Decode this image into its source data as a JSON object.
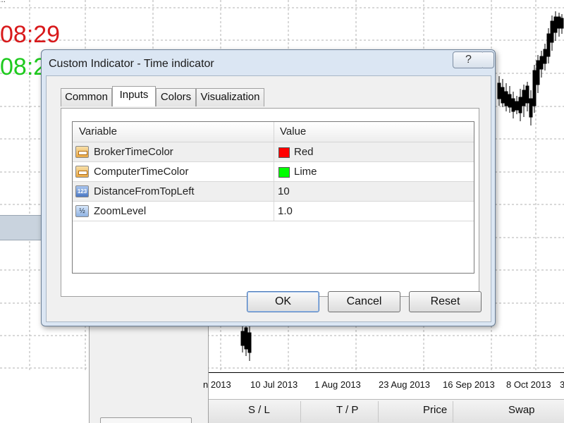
{
  "chart": {
    "title_fragment": "...",
    "broker_time": "08:29",
    "computer_time": "08:2",
    "broker_color": "#d8191b",
    "computer_color": "#1fca1f",
    "date_labels": [
      "n 2013",
      "10 Jul 2013",
      "1 Aug 2013",
      "23 Aug 2013",
      "16 Sep 2013",
      "8 Oct 2013",
      "3"
    ]
  },
  "terminal": {
    "columns": [
      "S / L",
      "T / P",
      "Price",
      "Swap"
    ]
  },
  "dialog": {
    "title": "Custom Indicator - Time indicator",
    "help_label": "?",
    "tabs": [
      {
        "label": "Common",
        "active": false
      },
      {
        "label": "Inputs",
        "active": true
      },
      {
        "label": "Colors",
        "active": false
      },
      {
        "label": "Visualization",
        "active": false
      }
    ],
    "grid": {
      "headers": {
        "variable": "Variable",
        "value": "Value"
      },
      "rows": [
        {
          "icon": "color-variable-icon",
          "variable": "BrokerTimeColor",
          "value": "Red",
          "swatch": "#ff0000"
        },
        {
          "icon": "color-variable-icon",
          "variable": "ComputerTimeColor",
          "value": "Lime",
          "swatch": "#00ff00"
        },
        {
          "icon": "integer-variable-icon",
          "icon_text": "123",
          "variable": "DistanceFromTopLeft",
          "value": "10"
        },
        {
          "icon": "double-variable-icon",
          "icon_text": "½",
          "variable": "ZoomLevel",
          "value": "1.0"
        }
      ]
    },
    "buttons": {
      "ok": "OK",
      "cancel": "Cancel",
      "reset": "Reset"
    }
  }
}
